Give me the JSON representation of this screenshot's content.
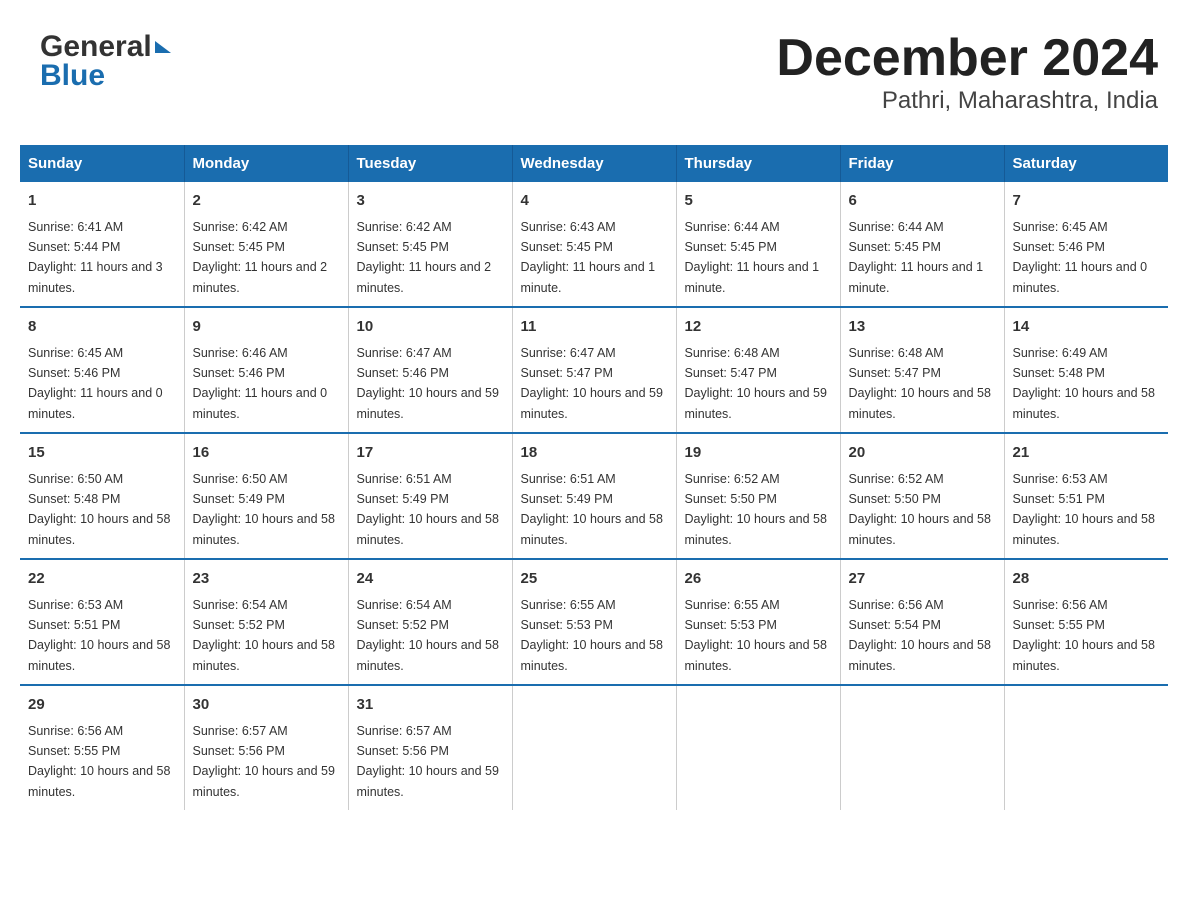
{
  "header": {
    "title": "December 2024",
    "subtitle": "Pathri, Maharashtra, India",
    "logo_general": "General",
    "logo_blue": "Blue"
  },
  "days_of_week": [
    "Sunday",
    "Monday",
    "Tuesday",
    "Wednesday",
    "Thursday",
    "Friday",
    "Saturday"
  ],
  "weeks": [
    [
      {
        "day": "1",
        "sunrise": "6:41 AM",
        "sunset": "5:44 PM",
        "daylight": "11 hours and 3 minutes."
      },
      {
        "day": "2",
        "sunrise": "6:42 AM",
        "sunset": "5:45 PM",
        "daylight": "11 hours and 2 minutes."
      },
      {
        "day": "3",
        "sunrise": "6:42 AM",
        "sunset": "5:45 PM",
        "daylight": "11 hours and 2 minutes."
      },
      {
        "day": "4",
        "sunrise": "6:43 AM",
        "sunset": "5:45 PM",
        "daylight": "11 hours and 1 minute."
      },
      {
        "day": "5",
        "sunrise": "6:44 AM",
        "sunset": "5:45 PM",
        "daylight": "11 hours and 1 minute."
      },
      {
        "day": "6",
        "sunrise": "6:44 AM",
        "sunset": "5:45 PM",
        "daylight": "11 hours and 1 minute."
      },
      {
        "day": "7",
        "sunrise": "6:45 AM",
        "sunset": "5:46 PM",
        "daylight": "11 hours and 0 minutes."
      }
    ],
    [
      {
        "day": "8",
        "sunrise": "6:45 AM",
        "sunset": "5:46 PM",
        "daylight": "11 hours and 0 minutes."
      },
      {
        "day": "9",
        "sunrise": "6:46 AM",
        "sunset": "5:46 PM",
        "daylight": "11 hours and 0 minutes."
      },
      {
        "day": "10",
        "sunrise": "6:47 AM",
        "sunset": "5:46 PM",
        "daylight": "10 hours and 59 minutes."
      },
      {
        "day": "11",
        "sunrise": "6:47 AM",
        "sunset": "5:47 PM",
        "daylight": "10 hours and 59 minutes."
      },
      {
        "day": "12",
        "sunrise": "6:48 AM",
        "sunset": "5:47 PM",
        "daylight": "10 hours and 59 minutes."
      },
      {
        "day": "13",
        "sunrise": "6:48 AM",
        "sunset": "5:47 PM",
        "daylight": "10 hours and 58 minutes."
      },
      {
        "day": "14",
        "sunrise": "6:49 AM",
        "sunset": "5:48 PM",
        "daylight": "10 hours and 58 minutes."
      }
    ],
    [
      {
        "day": "15",
        "sunrise": "6:50 AM",
        "sunset": "5:48 PM",
        "daylight": "10 hours and 58 minutes."
      },
      {
        "day": "16",
        "sunrise": "6:50 AM",
        "sunset": "5:49 PM",
        "daylight": "10 hours and 58 minutes."
      },
      {
        "day": "17",
        "sunrise": "6:51 AM",
        "sunset": "5:49 PM",
        "daylight": "10 hours and 58 minutes."
      },
      {
        "day": "18",
        "sunrise": "6:51 AM",
        "sunset": "5:49 PM",
        "daylight": "10 hours and 58 minutes."
      },
      {
        "day": "19",
        "sunrise": "6:52 AM",
        "sunset": "5:50 PM",
        "daylight": "10 hours and 58 minutes."
      },
      {
        "day": "20",
        "sunrise": "6:52 AM",
        "sunset": "5:50 PM",
        "daylight": "10 hours and 58 minutes."
      },
      {
        "day": "21",
        "sunrise": "6:53 AM",
        "sunset": "5:51 PM",
        "daylight": "10 hours and 58 minutes."
      }
    ],
    [
      {
        "day": "22",
        "sunrise": "6:53 AM",
        "sunset": "5:51 PM",
        "daylight": "10 hours and 58 minutes."
      },
      {
        "day": "23",
        "sunrise": "6:54 AM",
        "sunset": "5:52 PM",
        "daylight": "10 hours and 58 minutes."
      },
      {
        "day": "24",
        "sunrise": "6:54 AM",
        "sunset": "5:52 PM",
        "daylight": "10 hours and 58 minutes."
      },
      {
        "day": "25",
        "sunrise": "6:55 AM",
        "sunset": "5:53 PM",
        "daylight": "10 hours and 58 minutes."
      },
      {
        "day": "26",
        "sunrise": "6:55 AM",
        "sunset": "5:53 PM",
        "daylight": "10 hours and 58 minutes."
      },
      {
        "day": "27",
        "sunrise": "6:56 AM",
        "sunset": "5:54 PM",
        "daylight": "10 hours and 58 minutes."
      },
      {
        "day": "28",
        "sunrise": "6:56 AM",
        "sunset": "5:55 PM",
        "daylight": "10 hours and 58 minutes."
      }
    ],
    [
      {
        "day": "29",
        "sunrise": "6:56 AM",
        "sunset": "5:55 PM",
        "daylight": "10 hours and 58 minutes."
      },
      {
        "day": "30",
        "sunrise": "6:57 AM",
        "sunset": "5:56 PM",
        "daylight": "10 hours and 59 minutes."
      },
      {
        "day": "31",
        "sunrise": "6:57 AM",
        "sunset": "5:56 PM",
        "daylight": "10 hours and 59 minutes."
      },
      null,
      null,
      null,
      null
    ]
  ]
}
